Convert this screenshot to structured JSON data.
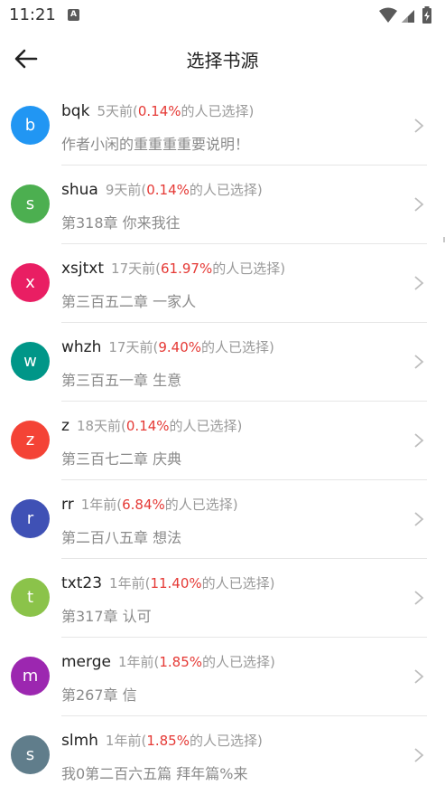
{
  "status_bar": {
    "time": "11:21",
    "notification_icon": "A"
  },
  "toolbar": {
    "title": "选择书源"
  },
  "sources": [
    {
      "letter": "b",
      "color": "#2196f3",
      "name": "bqk",
      "time": "5天前(",
      "percent": "0.14%",
      "suffix": "的人已选择)",
      "latest": "作者小闲的重重重重要说明！"
    },
    {
      "letter": "s",
      "color": "#4caf50",
      "name": "shua",
      "time": "9天前(",
      "percent": "0.14%",
      "suffix": "的人已选择)",
      "latest": "第318章 你来我往"
    },
    {
      "letter": "x",
      "color": "#e91e63",
      "name": "xsjtxt",
      "time": "17天前(",
      "percent": "61.97%",
      "suffix": "的人已选择)",
      "latest": "第三百五二章 一家人"
    },
    {
      "letter": "w",
      "color": "#009688",
      "name": "whzh",
      "time": "17天前(",
      "percent": "9.40%",
      "suffix": "的人已选择)",
      "latest": "第三百五一章 生意"
    },
    {
      "letter": "z",
      "color": "#f44336",
      "name": "z",
      "time": "18天前(",
      "percent": "0.14%",
      "suffix": "的人已选择)",
      "latest": "第三百七二章 庆典"
    },
    {
      "letter": "r",
      "color": "#3f51b5",
      "name": "rr",
      "time": "1年前(",
      "percent": "6.84%",
      "suffix": "的人已选择)",
      "latest": "第二百八五章 想法"
    },
    {
      "letter": "t",
      "color": "#8bc34a",
      "name": "txt23",
      "time": "1年前(",
      "percent": "11.40%",
      "suffix": "的人已选择)",
      "latest": "第317章 认可"
    },
    {
      "letter": "m",
      "color": "#9c27b0",
      "name": "merge",
      "time": "1年前(",
      "percent": "1.85%",
      "suffix": "的人已选择)",
      "latest": "第267章 信"
    },
    {
      "letter": "s",
      "color": "#607d8b",
      "name": "slmh",
      "time": "1年前(",
      "percent": "1.85%",
      "suffix": "的人已选择)",
      "latest": "我0第二百六五篇 拜年篇%来"
    }
  ],
  "icons": {
    "back": "arrow-left-icon",
    "chevron": "chevron-right-icon",
    "wifi": "wifi-icon",
    "signal": "signal-icon",
    "battery": "battery-charging-icon"
  }
}
